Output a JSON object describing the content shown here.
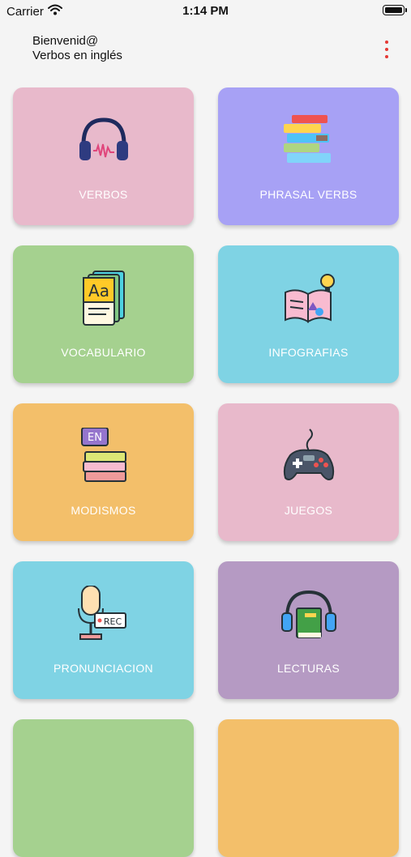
{
  "status_bar": {
    "carrier": "Carrier",
    "time": "1:14 PM"
  },
  "header": {
    "greeting": "Bienvenid@",
    "subtitle": "Verbos en inglés"
  },
  "tiles": [
    {
      "label": "VERBOS",
      "color": "#e8b9cb",
      "icon": "headphones-icon"
    },
    {
      "label": "PHRASAL VERBS",
      "color": "#a7a1f5",
      "icon": "books-stack-icon"
    },
    {
      "label": "VOCABULARIO",
      "color": "#a5d18f",
      "icon": "flashcards-icon"
    },
    {
      "label": "INFOGRAFIAS",
      "color": "#7fd3e4",
      "icon": "open-book-idea-icon"
    },
    {
      "label": "MODISMOS",
      "color": "#f3bf6a",
      "icon": "english-books-icon"
    },
    {
      "label": "JUEGOS",
      "color": "#e8b9cb",
      "icon": "gamepad-icon"
    },
    {
      "label": "PRONUNCIACION",
      "color": "#7fd3e4",
      "icon": "microphone-rec-icon"
    },
    {
      "label": "LECTURAS",
      "color": "#b59ac3",
      "icon": "audiobook-icon"
    },
    {
      "label": "",
      "color": "#a5d18f",
      "icon": ""
    },
    {
      "label": "",
      "color": "#f3bf6a",
      "icon": ""
    }
  ]
}
